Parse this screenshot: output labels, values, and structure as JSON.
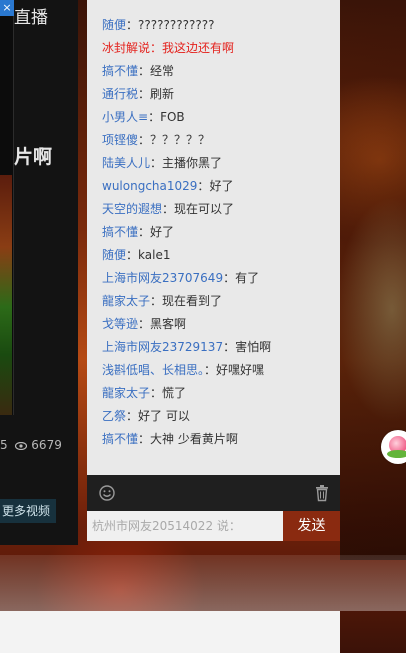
{
  "video_panel": {
    "close_label": "×",
    "live_title": "直播",
    "big_title": "片啊",
    "stats_left": "5",
    "views": "6679",
    "more_videos_label": "更多视频"
  },
  "chat": {
    "messages": [
      {
        "nick": "随便",
        "sep": "：",
        "text": "????????????",
        "highlight": false
      },
      {
        "nick": "冰封解说",
        "sep": "：",
        "text": "我这边还有啊",
        "highlight": true
      },
      {
        "nick": "搞不懂",
        "sep": "：",
        "text": "经常",
        "highlight": false
      },
      {
        "nick": "通行税",
        "sep": "：",
        "text": "刷新",
        "highlight": false
      },
      {
        "nick": "小男人≡",
        "sep": "：",
        "text": "FOB",
        "highlight": false
      },
      {
        "nick": "项铿傻",
        "sep": "：",
        "text": "？？？？？",
        "highlight": false
      },
      {
        "nick": "陆美人儿",
        "sep": "：",
        "text": "主播你黑了",
        "highlight": false
      },
      {
        "nick": "wulongcha1029",
        "sep": "：",
        "text": "好了",
        "highlight": false
      },
      {
        "nick": "天空的遐想",
        "sep": "：",
        "text": "现在可以了",
        "highlight": false
      },
      {
        "nick": "搞不懂",
        "sep": "：",
        "text": "好了",
        "highlight": false
      },
      {
        "nick": "随便",
        "sep": "：",
        "text": "kale1",
        "highlight": false
      },
      {
        "nick": "上海市网友23707649",
        "sep": "：",
        "text": "有了",
        "highlight": false
      },
      {
        "nick": "龍家太子",
        "sep": "：",
        "text": "现在看到了",
        "highlight": false
      },
      {
        "nick": "戈等逊",
        "sep": "：",
        "text": "黑客啊",
        "highlight": false
      },
      {
        "nick": "上海市网友23729137",
        "sep": "：",
        "text": "害怕啊",
        "highlight": false
      },
      {
        "nick": "浅斟低唱、长相思。",
        "sep": "：",
        "text": "好嘿好嘿",
        "highlight": false
      },
      {
        "nick": "龍家太子",
        "sep": "：",
        "text": "慌了",
        "highlight": false
      },
      {
        "nick": "乙祭",
        "sep": "：",
        "text": "好了  可以",
        "highlight": false
      },
      {
        "nick": "搞不懂",
        "sep": "：",
        "text": "大神  少看黄片啊",
        "highlight": false
      }
    ],
    "input_placeholder": "杭州市网友20514022 说：",
    "send_label": "发送"
  },
  "icons": {
    "close": "close-icon",
    "eye": "eye-icon",
    "emoji": "smile-icon",
    "trash": "trash-icon",
    "peach": "peach-icon"
  },
  "colors": {
    "nick": "#3a6fc1",
    "highlight": "#e4231e",
    "send_button": "#8a2a10",
    "toolbar": "#1f1f1f",
    "chat_bg": "#e9e9e9"
  }
}
